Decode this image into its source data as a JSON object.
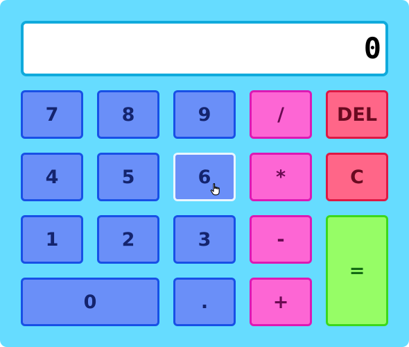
{
  "display": {
    "value": "0"
  },
  "keys": {
    "seven": "7",
    "eight": "8",
    "nine": "9",
    "divide": "/",
    "delete": "DEL",
    "four": "4",
    "five": "5",
    "six": "6",
    "multiply": "*",
    "clear": "C",
    "one": "1",
    "two": "2",
    "three": "3",
    "subtract": "-",
    "equals": "=",
    "zero": "0",
    "decimal": ".",
    "add": "+"
  },
  "hovered_key": "6",
  "cursor_icon": "hand-pointer-icon",
  "colors": {
    "background": "#66dcff",
    "display_border": "#10aadc",
    "number_key": "#6a8ff8",
    "number_border": "#1850e6",
    "operator_key": "#fd66d4",
    "operator_border": "#dd18b4",
    "clear_key": "#ff6688",
    "clear_border": "#de1844",
    "equals_key": "#96fd66",
    "equals_border": "#3cd81c",
    "hover_border": "#e8f6ff"
  }
}
